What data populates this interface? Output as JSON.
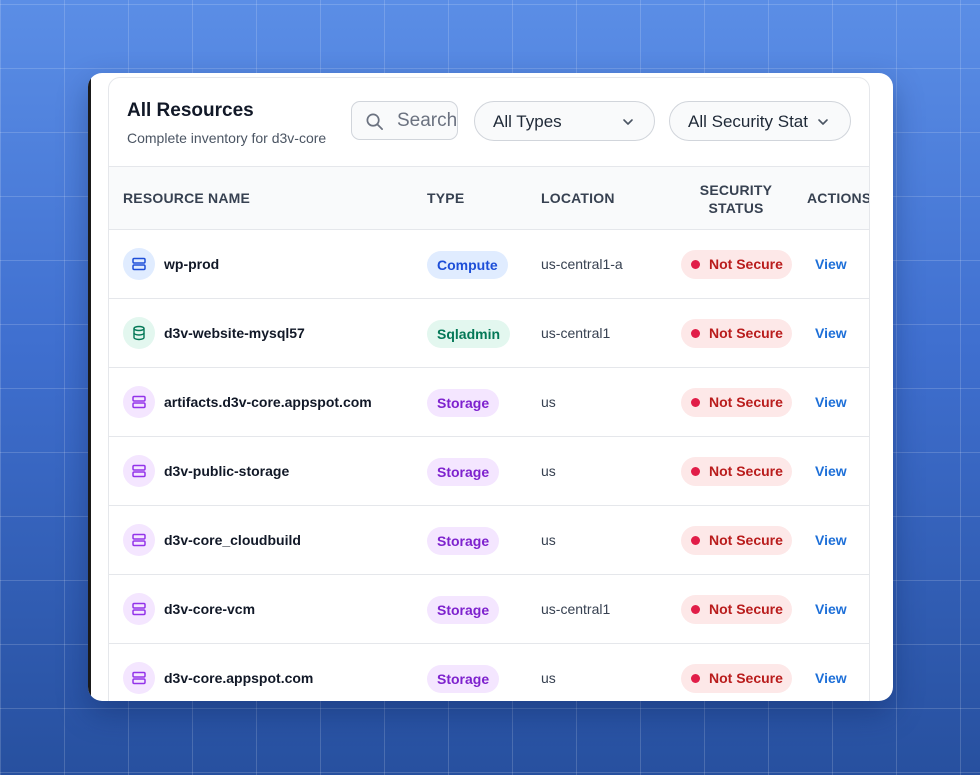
{
  "header": {
    "title": "All Resources",
    "subtitle": "Complete inventory for d3v-core",
    "search_placeholder": "Search",
    "type_filter": "All Types",
    "security_filter": "All Security Status"
  },
  "table": {
    "columns": {
      "name": "RESOURCE NAME",
      "type": "TYPE",
      "location": "LOCATION",
      "security_line1": "SECURITY",
      "security_line2": "STATUS",
      "actions": "ACTIONS"
    },
    "rows": [
      {
        "name": "wp-prod",
        "type": "Compute",
        "kind": "compute",
        "location": "us-central1-a",
        "status": "Not Secure",
        "action": "View"
      },
      {
        "name": "d3v-website-mysql57",
        "type": "Sqladmin",
        "kind": "sqladmin",
        "location": "us-central1",
        "status": "Not Secure",
        "action": "View"
      },
      {
        "name": "artifacts.d3v-core.appspot.com",
        "type": "Storage",
        "kind": "storage",
        "location": "us",
        "status": "Not Secure",
        "action": "View"
      },
      {
        "name": "d3v-public-storage",
        "type": "Storage",
        "kind": "storage",
        "location": "us",
        "status": "Not Secure",
        "action": "View"
      },
      {
        "name": "d3v-core_cloudbuild",
        "type": "Storage",
        "kind": "storage",
        "location": "us",
        "status": "Not Secure",
        "action": "View"
      },
      {
        "name": "d3v-core-vcm",
        "type": "Storage",
        "kind": "storage",
        "location": "us-central1",
        "status": "Not Secure",
        "action": "View"
      },
      {
        "name": "d3v-core.appspot.com",
        "type": "Storage",
        "kind": "storage",
        "location": "us",
        "status": "Not Secure",
        "action": "View"
      }
    ]
  },
  "colors": {
    "compute": "#1d4ed8",
    "sqladmin": "#047857",
    "storage": "#7e22ce",
    "not_secure": "#e11d48",
    "link": "#1d6fd8"
  },
  "icons": {
    "compute": "server-icon",
    "sqladmin": "database-icon",
    "storage": "storage-bucket-icon",
    "search": "search-icon",
    "dropdown": "chevron-down-icon"
  }
}
